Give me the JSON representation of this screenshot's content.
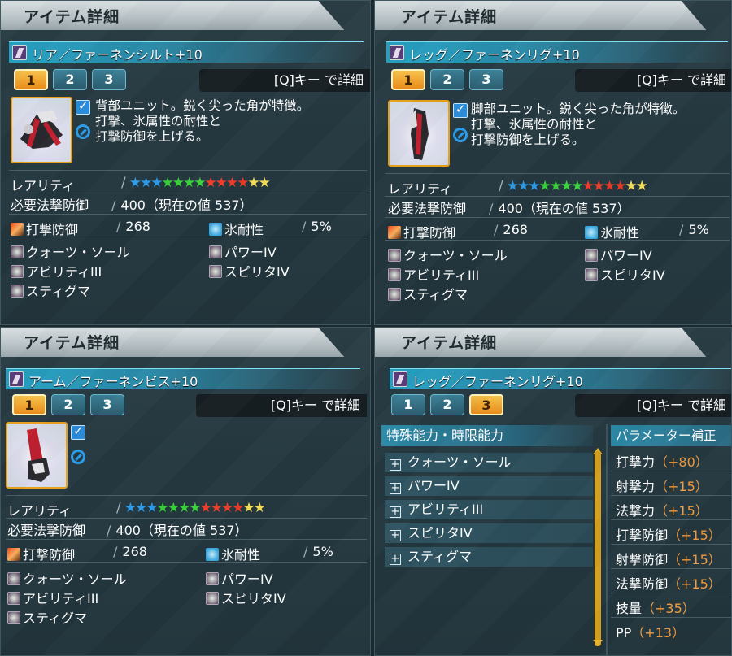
{
  "panels": [
    {
      "title": "アイテム詳細",
      "item_name": "リア／ファーネンシルト+10",
      "tabs": [
        "1",
        "2",
        "3"
      ],
      "active_tab": "1",
      "detail_key": "[Q]キー で詳細",
      "description": [
        "背部ユニット。鋭く尖った角が特徴。",
        "打撃、氷属性の耐性と",
        "打撃防御を上げる。"
      ],
      "rarity_label": "レアリティ",
      "rarity_stars": 13,
      "req_label": "必要法撃防御",
      "req_value": "400（現在の値 537）",
      "def_label": "打撃防御",
      "def_value": "268",
      "res_label": "氷耐性",
      "res_value": "5%",
      "affixes_left": [
        "クォーツ・ソール",
        "アビリティIII",
        "スティグマ"
      ],
      "affixes_right": [
        "パワーIV",
        "スピリタIV"
      ]
    },
    {
      "title": "アイテム詳細",
      "item_name": "レッグ／ファーネンリグ+10",
      "tabs": [
        "1",
        "2",
        "3"
      ],
      "active_tab": "1",
      "detail_key": "[Q]キー で詳細",
      "description": [
        "脚部ユニット。鋭く尖った角が特徴。",
        "打撃、氷属性の耐性と",
        "打撃防御を上げる。"
      ],
      "rarity_label": "レアリティ",
      "rarity_stars": 13,
      "req_label": "必要法撃防御",
      "req_value": "400（現在の値 537）",
      "def_label": "打撃防御",
      "def_value": "268",
      "res_label": "氷耐性",
      "res_value": "5%",
      "affixes_left": [
        "クォーツ・ソール",
        "アビリティIII",
        "スティグマ"
      ],
      "affixes_right": [
        "パワーIV",
        "スピリタIV"
      ]
    },
    {
      "title": "アイテム詳細",
      "item_name": "アーム／ファーネンビス+10",
      "tabs": [
        "1",
        "2",
        "3"
      ],
      "active_tab": "1",
      "detail_key": "[Q]キー で詳細",
      "description": [],
      "rarity_label": "レアリティ",
      "rarity_stars": 13,
      "req_label": "必要法撃防御",
      "req_value": "400（現在の値 537）",
      "def_label": "打撃防御",
      "def_value": "268",
      "res_label": "氷耐性",
      "res_value": "5%",
      "affixes_left": [
        "クォーツ・ソール",
        "アビリティIII",
        "スティグマ"
      ],
      "affixes_right": [
        "パワーIV",
        "スピリタIV"
      ]
    },
    {
      "title": "アイテム詳細",
      "item_name": "レッグ／ファーネンリグ+10",
      "tabs": [
        "1",
        "2",
        "3"
      ],
      "active_tab": "3",
      "detail_key": "[Q]キー で詳細",
      "special_header": "特殊能力・時限能力",
      "special_items": [
        "クォーツ・ソール",
        "パワーIV",
        "アビリティIII",
        "スピリタIV",
        "スティグマ"
      ],
      "param_header": "パラメーター補正",
      "params": [
        {
          "label": "打撃力",
          "bonus": "（+80）"
        },
        {
          "label": "射撃力",
          "bonus": "（+15）"
        },
        {
          "label": "法撃力",
          "bonus": "（+15）"
        },
        {
          "label": "打撃防御",
          "bonus": "（+15）"
        },
        {
          "label": "射撃防御",
          "bonus": "（+15）"
        },
        {
          "label": "法撃防御",
          "bonus": "（+15）"
        },
        {
          "label": "技量",
          "bonus": "（+35）"
        },
        {
          "label": "PP",
          "bonus": "（+13）"
        }
      ]
    }
  ],
  "colors": {
    "accent_orange": "#e88a18",
    "bonus_orange": "#f29a3a",
    "star_blue": "#2e9be8",
    "star_green": "#39d23a",
    "star_red": "#ef3a28",
    "star_yellow": "#f6e05a"
  },
  "icons": {
    "def_icon": "strike-defense-icon",
    "res_icon": "ice-resist-icon",
    "affix_icon": "affix-icon",
    "check_icon": "check-icon",
    "lock_icon": "no-entry-icon"
  }
}
